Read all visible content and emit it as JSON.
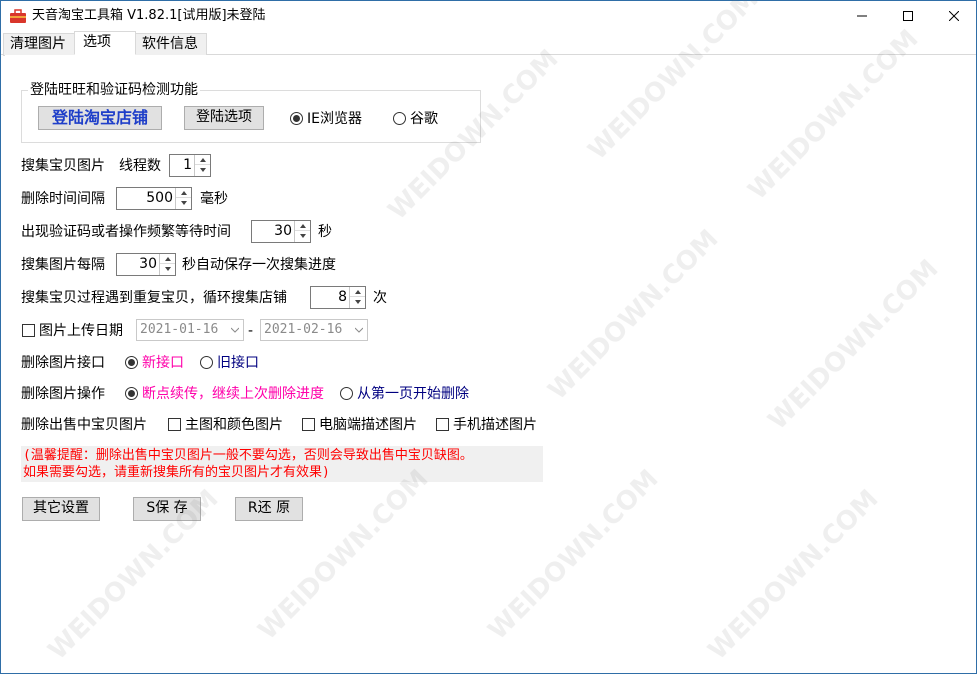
{
  "window": {
    "title": "天音淘宝工具箱 V1.82.1[试用版]未登陆",
    "icon": "toolbox-icon",
    "controls": [
      "minimize-icon",
      "maximize-icon",
      "close-icon"
    ]
  },
  "tabs": [
    {
      "label": "清理图片",
      "active": false
    },
    {
      "label": "选项",
      "active": true
    },
    {
      "label": "软件信息",
      "active": false
    }
  ],
  "login_group": {
    "title": "登陆旺旺和验证码检测功能",
    "login_shop_button": "登陆淘宝店铺",
    "login_options_button": "登陆选项",
    "browser_options": [
      {
        "label": "IE浏览器",
        "selected": true
      },
      {
        "label": "谷歌",
        "selected": false
      }
    ],
    "accent_color": "#1f3fc9"
  },
  "settings": {
    "collect_images_label": "搜集宝贝图片",
    "threads_label": "线程数",
    "threads_value": "1",
    "delete_interval_label": "删除时间间隔",
    "delete_interval_value": "500",
    "delete_interval_unit": "毫秒",
    "captcha_wait_label": "出现验证码或者操作频繁等待时间",
    "captcha_wait_value": "30",
    "captcha_wait_unit": "秒",
    "autosave_prefix": "搜集图片每隔",
    "autosave_value": "30",
    "autosave_suffix": "秒自动保存一次搜集进度",
    "duplicate_label": "搜集宝贝过程遇到重复宝贝，循环搜集店铺",
    "duplicate_value": "8",
    "duplicate_unit": "次",
    "upload_date_label": "图片上传日期",
    "upload_date_checked": false,
    "date_from": "2021-01-16",
    "date_separator": "-",
    "date_to": "2021-02-16",
    "delete_api_label": "删除图片接口",
    "delete_api_options": [
      {
        "label": "新接口",
        "selected": true,
        "color": "#ff00aa"
      },
      {
        "label": "旧接口",
        "selected": false,
        "color": "#000080"
      }
    ],
    "delete_op_label": "删除图片操作",
    "delete_op_options": [
      {
        "label": "断点续传，继续上次删除进度",
        "selected": true,
        "color": "#ff00aa"
      },
      {
        "label": "从第一页开始删除",
        "selected": false,
        "color": "#000080"
      }
    ],
    "delete_sold_label": "删除出售中宝贝图片",
    "delete_sold_options": [
      {
        "label": "主图和颜色图片",
        "checked": false
      },
      {
        "label": "电脑端描述图片",
        "checked": false
      },
      {
        "label": "手机描述图片",
        "checked": false
      }
    ]
  },
  "tip": {
    "line1": "(温馨提醒：删除出售中宝贝图片一般不要勾选，否则会导致出售中宝贝缺图。",
    "line2": "如果需要勾选，请重新搜集所有的宝贝图片才有效果)",
    "color": "#ff0000"
  },
  "buttons": {
    "other_settings": "其它设置",
    "save": "S保 存",
    "restore": "R还 原"
  },
  "watermark_text": "WEIDOWN.COM"
}
